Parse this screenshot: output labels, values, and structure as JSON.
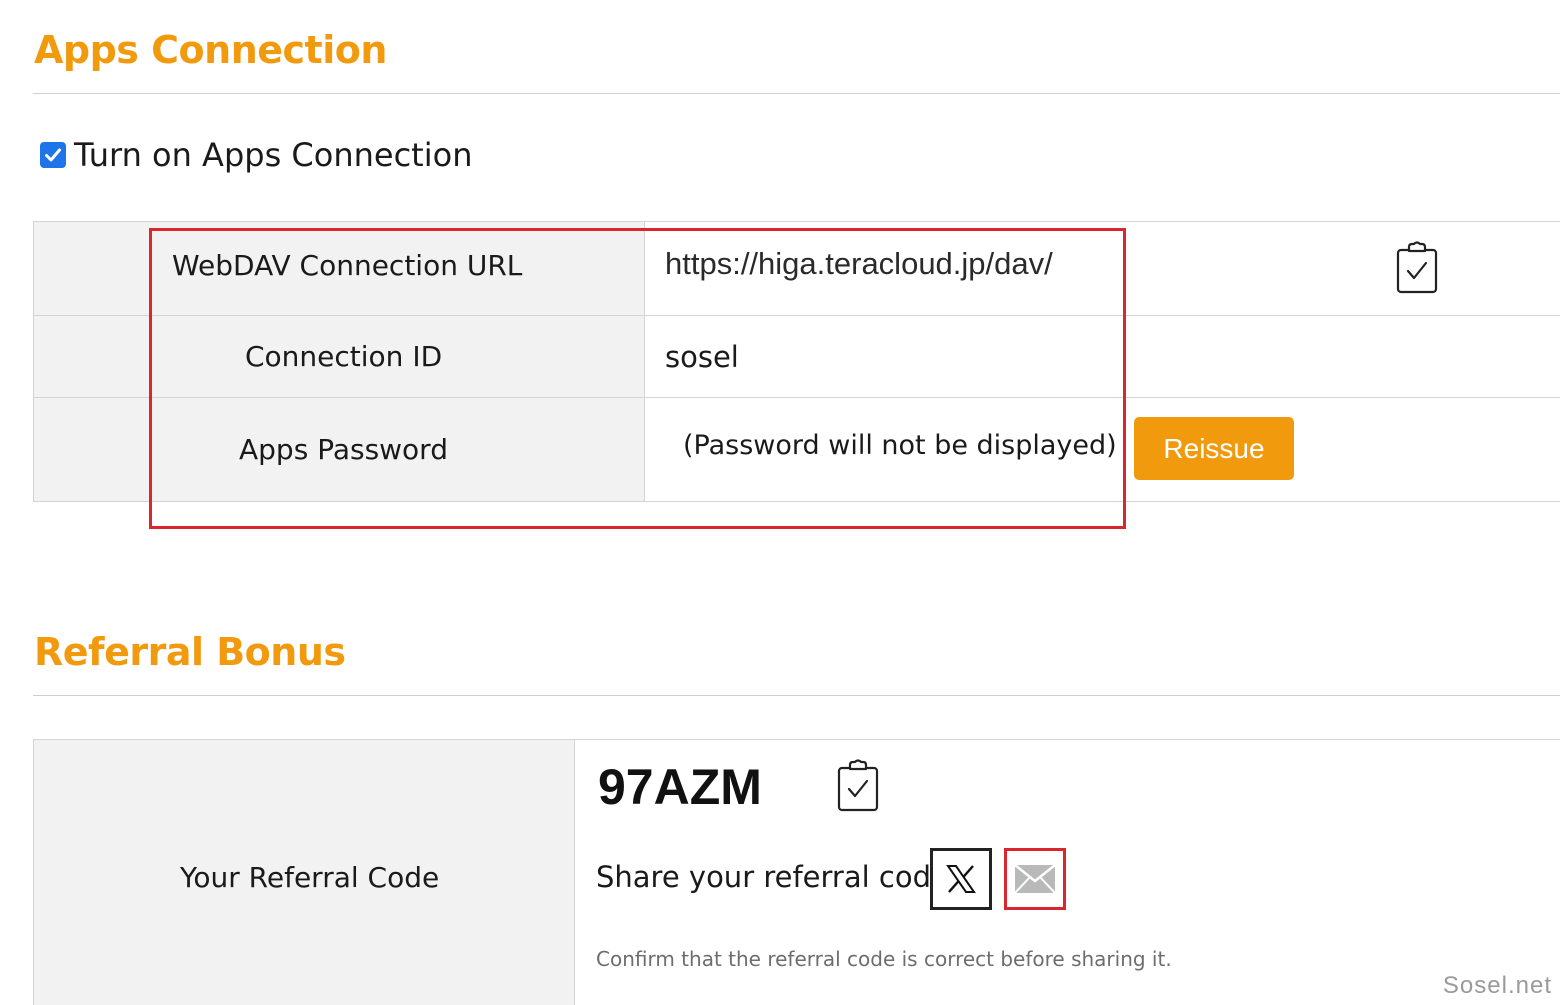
{
  "apps_connection": {
    "title": "Apps Connection",
    "toggle_label": "Turn on Apps Connection",
    "toggle_checked": true,
    "rows": {
      "webdav_url": {
        "label": "WebDAV Connection URL",
        "value": "https://higa.teracloud.jp/dav/"
      },
      "connection_id": {
        "label": "Connection ID",
        "value": "sosel"
      },
      "apps_password": {
        "label": "Apps Password",
        "value": "(Password will not be displayed)"
      }
    },
    "reissue_label": "Reissue"
  },
  "referral": {
    "title": "Referral Bonus",
    "code_label": "Your Referral Code",
    "code": "97AZM",
    "share_label": "Share your referral code:",
    "hint": "Confirm that the referral code is correct before sharing it."
  },
  "icons": {
    "copy": "clipboard-check-icon",
    "share_x": "x-logo-icon",
    "share_mail": "envelope-icon"
  },
  "colors": {
    "accent": "#f29a0e",
    "highlight": "#d9262f",
    "checkbox": "#1e74e8"
  },
  "watermark": "Sosel.net"
}
